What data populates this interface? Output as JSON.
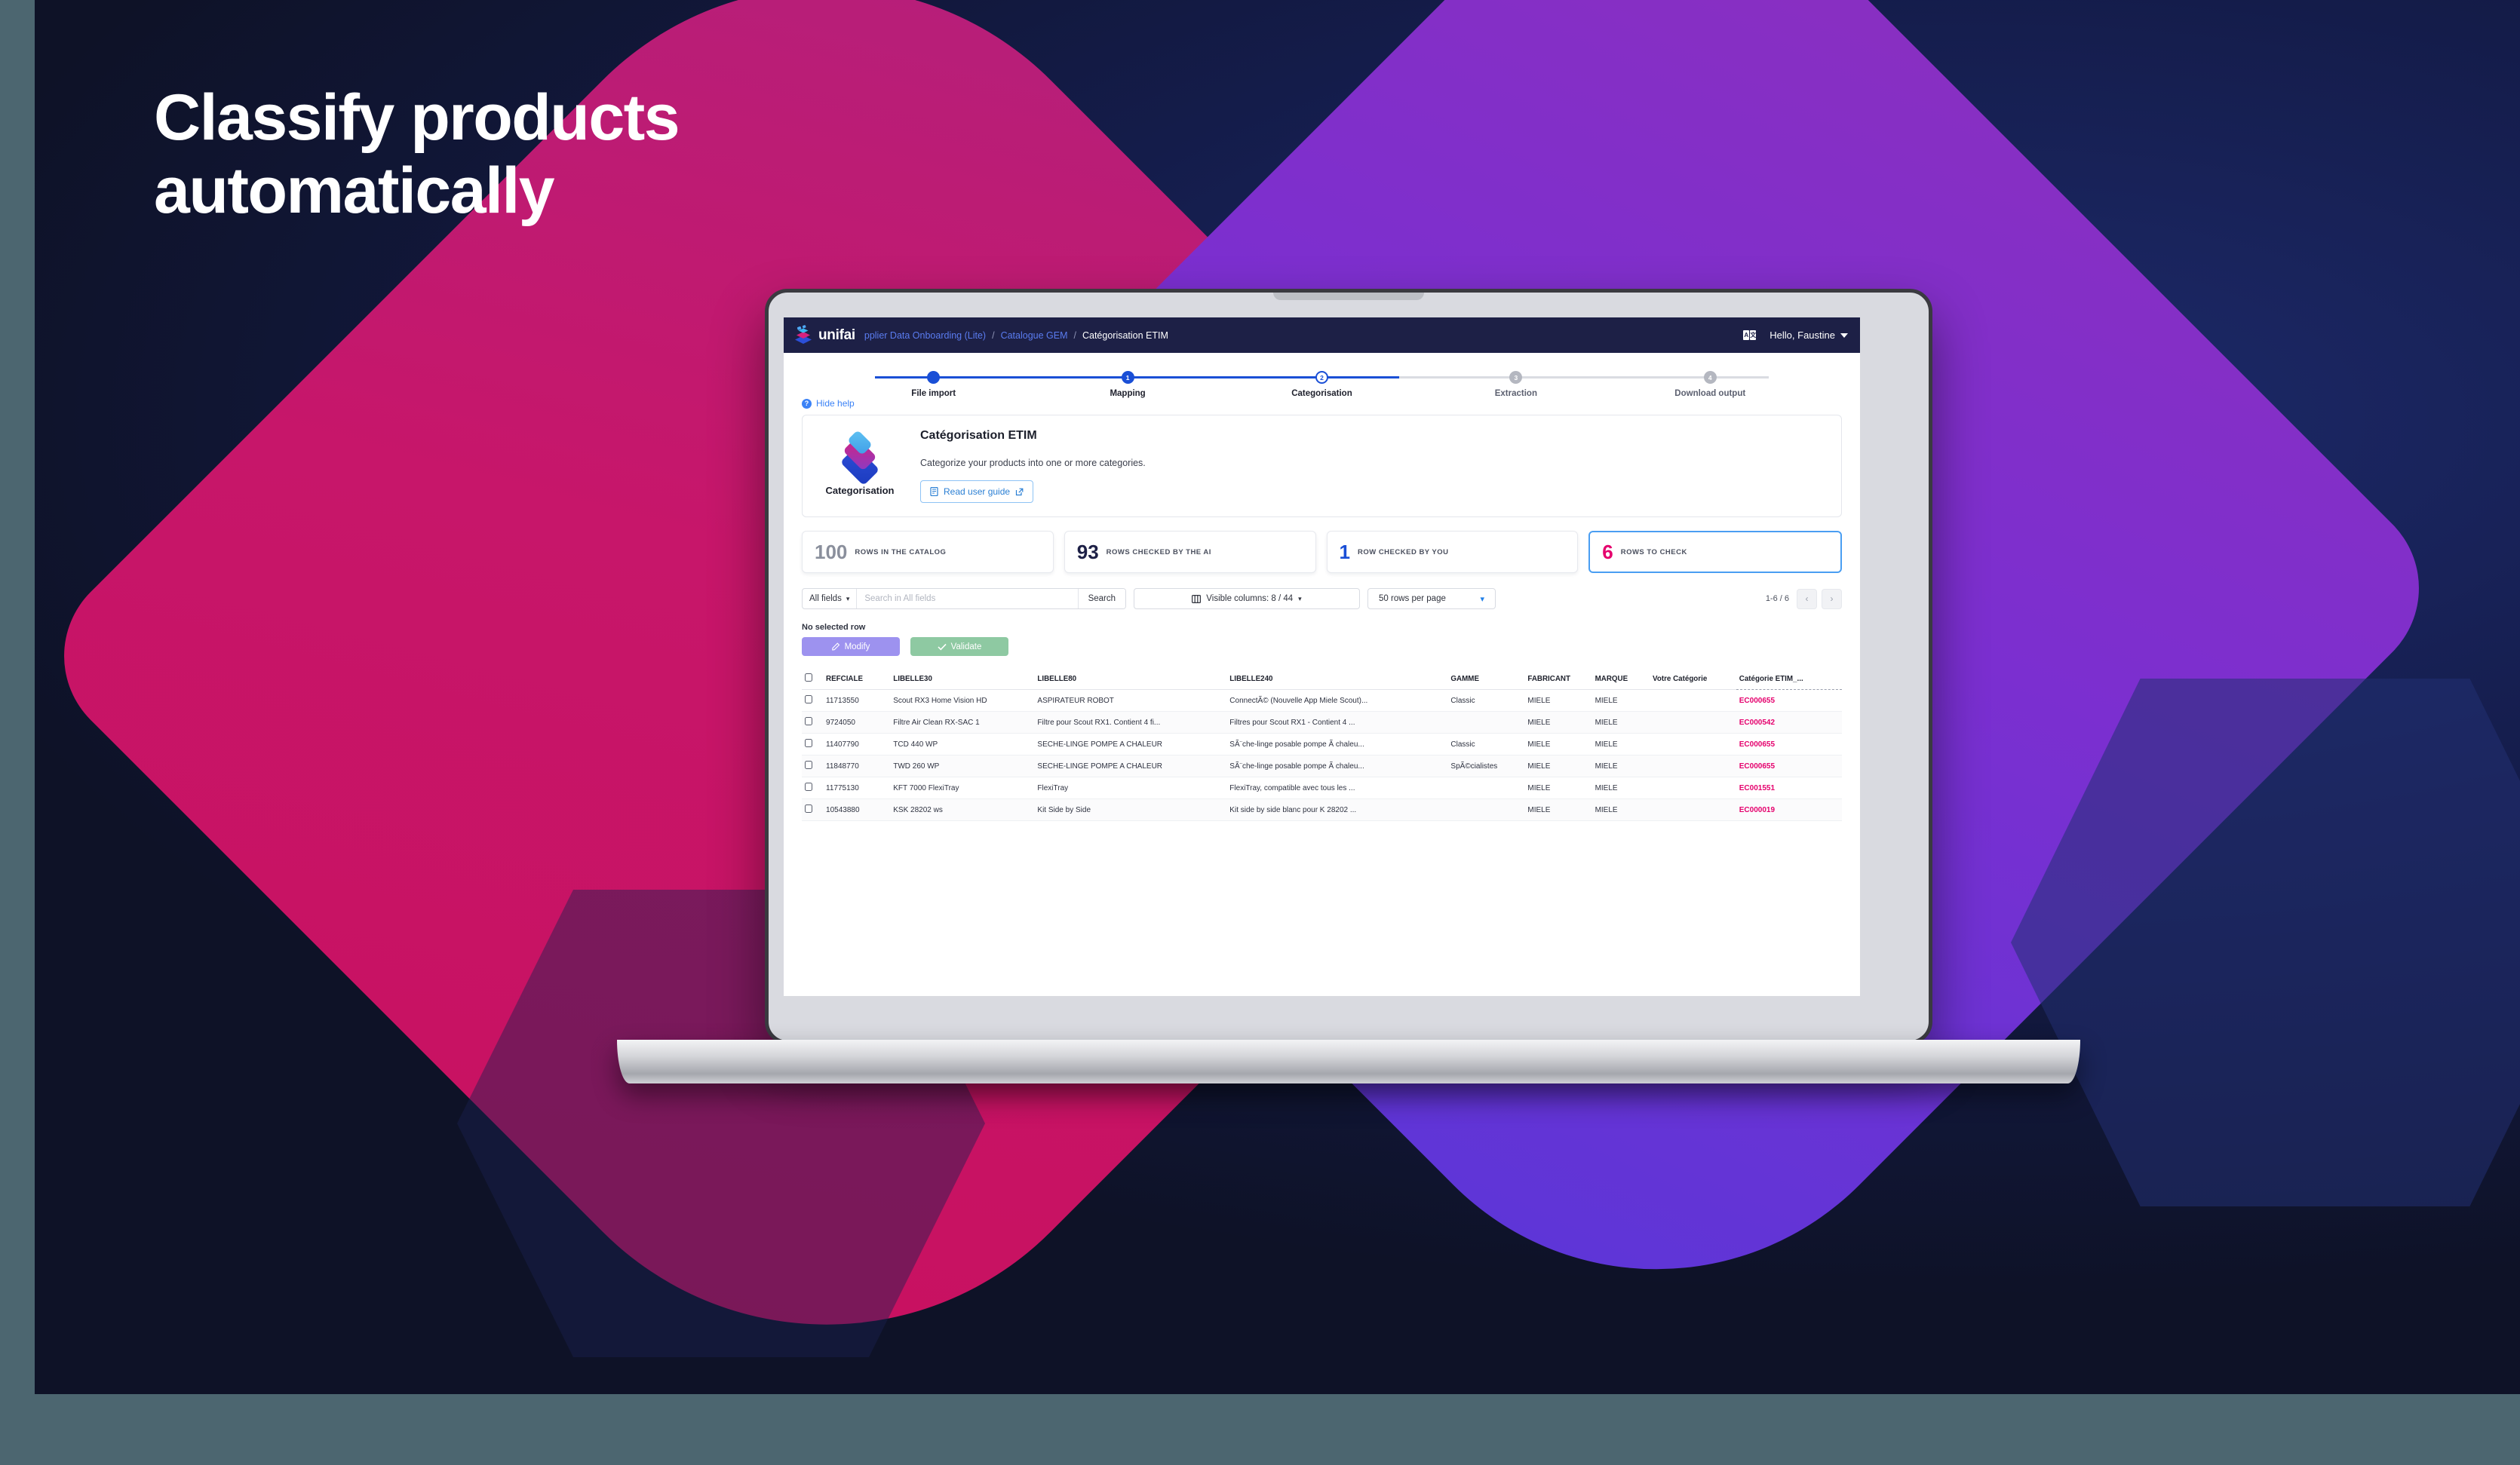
{
  "hero": {
    "line1": "Classify products",
    "line2": "automatically"
  },
  "colors": {
    "brand_navy": "#1d2046",
    "brand_blue": "#1a4fd6",
    "brand_pink": "#e5006d",
    "accent_magenta": "#c7166a",
    "accent_purple": "#7b2fd0",
    "link_blue": "#5a7cf0",
    "modify_purple": "#9d92ef",
    "validate_green": "#8ec9a2"
  },
  "navbar": {
    "logo_text": "unifai",
    "breadcrumb": [
      {
        "label": "pplier Data Onboarding (Lite)",
        "type": "link"
      },
      {
        "label": "/",
        "type": "sep"
      },
      {
        "label": "Catalogue GEM",
        "type": "link"
      },
      {
        "label": "/",
        "type": "sep"
      },
      {
        "label": "Catégorisation ETIM",
        "type": "current"
      }
    ],
    "language_icon": "translate-icon",
    "lang_a": "A",
    "lang_b": "文",
    "user_greeting": "Hello, Faustine"
  },
  "stepper": {
    "steps": [
      {
        "num": "",
        "label": "File import",
        "state": "done"
      },
      {
        "num": "1",
        "label": "Mapping",
        "state": "done"
      },
      {
        "num": "2",
        "label": "Categorisation",
        "state": "current"
      },
      {
        "num": "3",
        "label": "Extraction",
        "state": "todo"
      },
      {
        "num": "4",
        "label": "Download output",
        "state": "todo"
      }
    ]
  },
  "help": {
    "toggle_label": "Hide help",
    "toggle_icon": "question-circle-icon",
    "icon_label": "Categorisation",
    "title": "Catégorisation ETIM",
    "description": "Categorize your products into one or more categories.",
    "guide_button": "Read user guide",
    "guide_icon": "book-icon",
    "guide_external_icon": "external-link-icon"
  },
  "stats": [
    {
      "value": "100",
      "label": "ROWS IN THE CATALOG",
      "color": "#8a8f9c",
      "highlight": false
    },
    {
      "value": "93",
      "label": "ROWS CHECKED BY THE AI",
      "color": "#1d2046",
      "highlight": false
    },
    {
      "value": "1",
      "label": "ROW CHECKED BY YOU",
      "color": "#1a4fd6",
      "highlight": false
    },
    {
      "value": "6",
      "label": "ROWS TO CHECK",
      "color": "#e5006d",
      "highlight": true
    }
  ],
  "toolbar": {
    "field_select": "All fields",
    "search_placeholder": "Search in All fields",
    "search_value": "",
    "search_button": "Search",
    "visible_columns": "Visible columns: 8 / 44",
    "visible_columns_icon": "columns-icon",
    "rows_per_page": "50 rows per page",
    "pager_info": "1-6 / 6",
    "prev_icon": "chevron-left-icon",
    "next_icon": "chevron-right-icon"
  },
  "selection": {
    "status": "No selected row",
    "modify_label": "Modify",
    "modify_icon": "edit-icon",
    "validate_label": "Validate",
    "validate_icon": "check-icon"
  },
  "table": {
    "columns": [
      {
        "key": "chk",
        "label": ""
      },
      {
        "key": "ref",
        "label": "REFCIALE"
      },
      {
        "key": "l30",
        "label": "LIBELLE30"
      },
      {
        "key": "l80",
        "label": "LIBELLE80"
      },
      {
        "key": "l240",
        "label": "LIBELLE240"
      },
      {
        "key": "gam",
        "label": "GAMME"
      },
      {
        "key": "fab",
        "label": "FABRICANT"
      },
      {
        "key": "mar",
        "label": "MARQUE"
      },
      {
        "key": "vot",
        "label": "Votre Catégorie"
      },
      {
        "key": "cat",
        "label": "Catégorie ETIM_..."
      }
    ],
    "rows": [
      {
        "ref": "11713550",
        "l30": "Scout RX3 Home Vision HD",
        "l80": "ASPIRATEUR ROBOT",
        "l240": "ConnectÃ© (Nouvelle App Miele Scout)...",
        "gam": "Classic",
        "fab": "MIELE",
        "mar": "MIELE",
        "vot": "",
        "cat": "EC000655"
      },
      {
        "ref": "9724050",
        "l30": "Filtre Air Clean RX-SAC 1",
        "l80": "Filtre pour Scout RX1. Contient 4 fi...",
        "l240": "Filtres pour Scout RX1 - Contient 4 ...",
        "gam": "",
        "fab": "MIELE",
        "mar": "MIELE",
        "vot": "",
        "cat": "EC000542"
      },
      {
        "ref": "11407790",
        "l30": "TCD 440 WP",
        "l80": "SECHE-LINGE POMPE A CHALEUR",
        "l240": "SÃ¨che-linge posable pompe Ã  chaleu...",
        "gam": "Classic",
        "fab": "MIELE",
        "mar": "MIELE",
        "vot": "",
        "cat": "EC000655"
      },
      {
        "ref": "11848770",
        "l30": "TWD 260 WP",
        "l80": "SECHE-LINGE POMPE A CHALEUR",
        "l240": "SÃ¨che-linge posable pompe Ã  chaleu...",
        "gam": "SpÃ©cialistes",
        "fab": "MIELE",
        "mar": "MIELE",
        "vot": "",
        "cat": "EC000655"
      },
      {
        "ref": "11775130",
        "l30": "KFT 7000 FlexiTray",
        "l80": "FlexiTray",
        "l240": "FlexiTray, compatible avec tous les ...",
        "gam": "",
        "fab": "MIELE",
        "mar": "MIELE",
        "vot": "",
        "cat": "EC001551"
      },
      {
        "ref": "10543880",
        "l30": "KSK 28202 ws",
        "l80": "Kit Side by Side",
        "l240": "Kit side by side blanc pour K 28202 ...",
        "gam": "",
        "fab": "MIELE",
        "mar": "MIELE",
        "vot": "",
        "cat": "EC000019"
      }
    ]
  }
}
